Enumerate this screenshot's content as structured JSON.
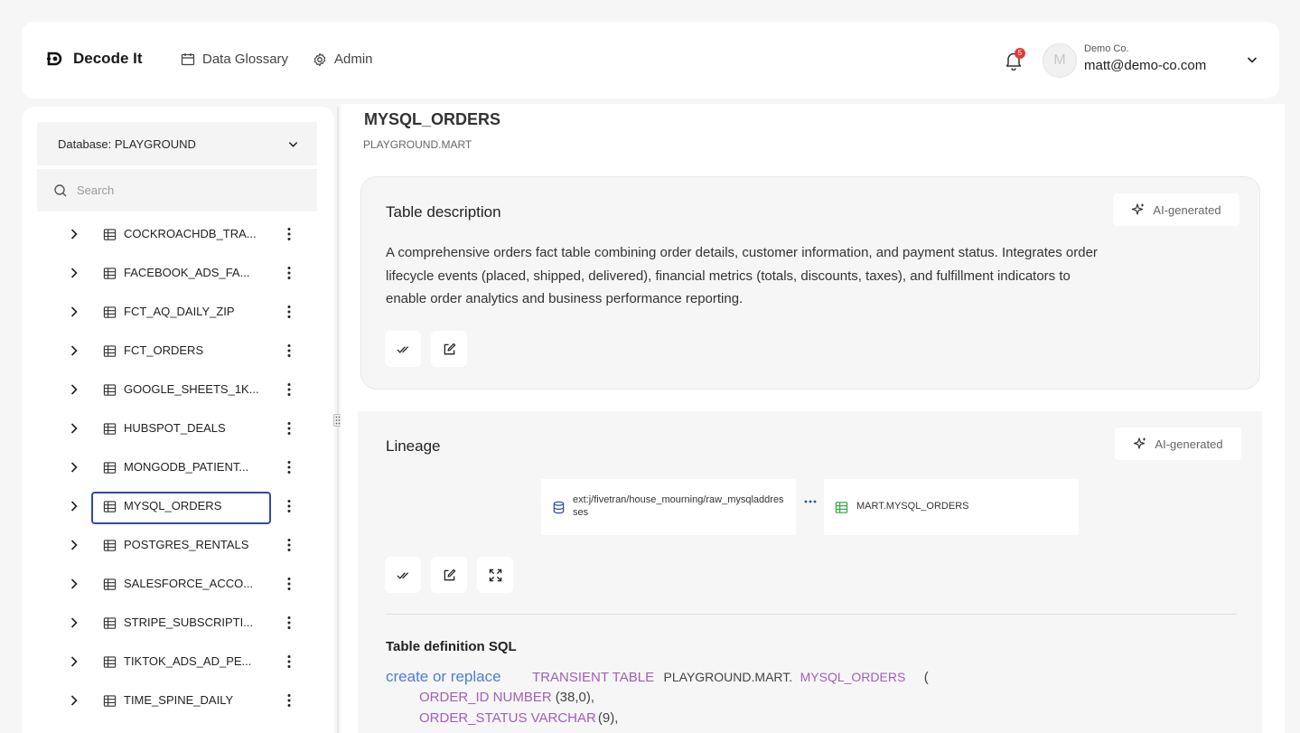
{
  "header": {
    "brand": "Decode It",
    "nav": [
      {
        "label": "Data Glossary",
        "icon": "calendar-icon"
      },
      {
        "label": "Admin",
        "icon": "gear-icon"
      }
    ],
    "notification_count": "5",
    "user": {
      "avatar_initial": "M",
      "company": "Demo Co.",
      "email": "matt@demo-co.com"
    }
  },
  "sidebar": {
    "database_label": "Database: PLAYGROUND",
    "search_placeholder": "Search",
    "tables": [
      "COCKROACHDB_TRA...",
      "FACEBOOK_ADS_FA...",
      "FCT_AQ_DAILY_ZIP",
      "FCT_ORDERS",
      "GOOGLE_SHEETS_1K...",
      "HUBSPOT_DEALS",
      "MONGODB_PATIENT...",
      "MYSQL_ORDERS",
      "POSTGRES_RENTALS",
      "SALESFORCE_ACCO...",
      "STRIPE_SUBSCRIPTI...",
      "TIKTOK_ADS_AD_PE...",
      "TIME_SPINE_DAILY"
    ],
    "selected_index": 7
  },
  "main": {
    "title": "MYSQL_ORDERS",
    "subtitle": "PLAYGROUND.MART",
    "description_card": {
      "title": "Table description",
      "badge": "AI-generated",
      "text": "A comprehensive orders fact table combining order details, customer information, and payment status. Integrates order lifecycle events (placed, shipped, delivered), financial metrics (totals, discounts, taxes), and fulfillment indicators to enable order analytics and business performance reporting."
    },
    "lineage_card": {
      "title": "Lineage",
      "badge": "AI-generated",
      "source_node": "ext:j/fivetran/house_mourning/raw_mysqladdresses",
      "target_node": "MART.MYSQL_ORDERS"
    },
    "sql": {
      "title": "Table definition SQL",
      "create": "create or replace",
      "kind": "TRANSIENT TABLE",
      "schema": "PLAYGROUND.MART.",
      "table": "MYSQL_ORDERS",
      "open_paren": "(",
      "col1_name": "ORDER_ID NUMBER",
      "col1_type": "(38,0),",
      "col2_name": "ORDER_STATUS VARCHAR",
      "col2_type": "(9),"
    }
  },
  "colors": {
    "accent": "#2f4aa8",
    "sql_keyword": "#4a7fd8",
    "sql_identifier": "#a25fb8",
    "badge_red": "#e53935"
  }
}
